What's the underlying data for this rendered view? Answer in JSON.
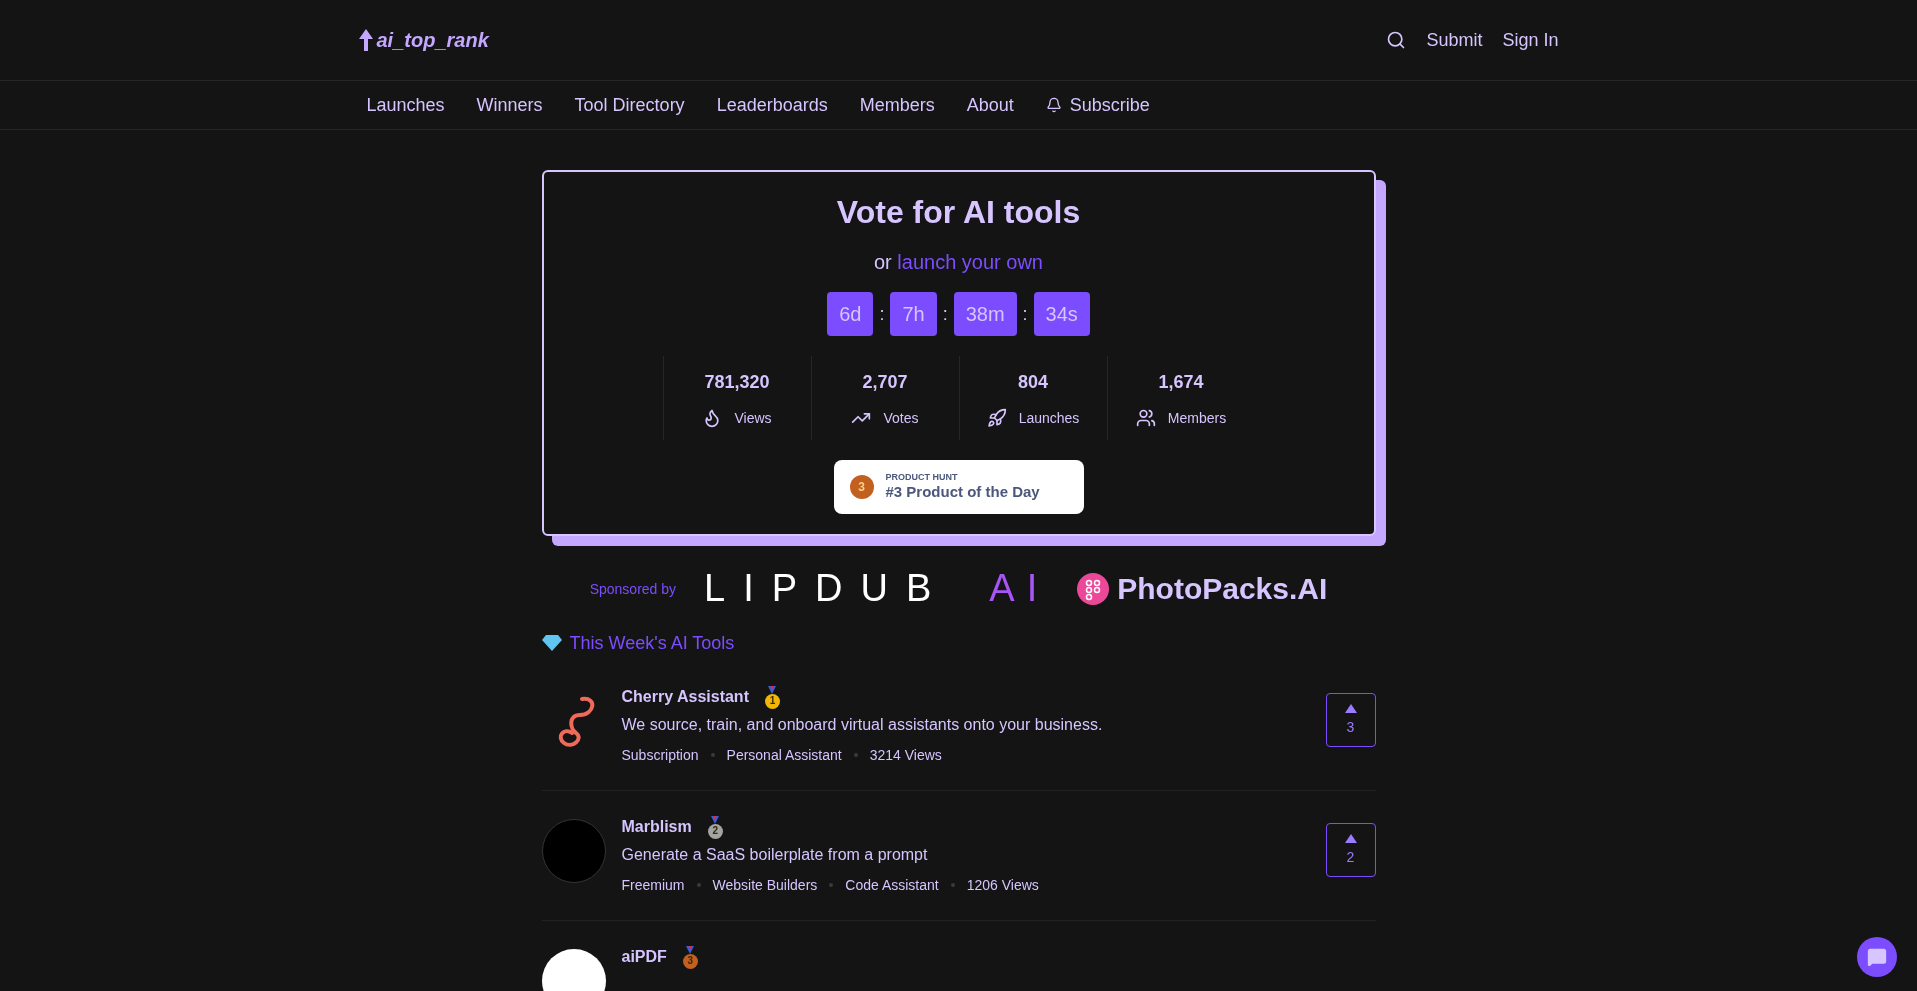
{
  "header": {
    "logo": "ai_top_rank",
    "actions": [
      "Submit",
      "Sign In"
    ]
  },
  "nav": [
    {
      "label": "Launches",
      "kind": "link"
    },
    {
      "label": "Winners",
      "kind": "link"
    },
    {
      "label": "Tool Directory",
      "kind": "link"
    },
    {
      "label": "Leaderboards",
      "kind": "link"
    },
    {
      "label": "Members",
      "kind": "link"
    },
    {
      "label": "About",
      "kind": "link"
    },
    {
      "label": "Subscribe",
      "kind": "bell"
    }
  ],
  "hero": {
    "title": "Vote for AI tools",
    "subtitle_prefix": "or",
    "subtitle_link": "launch your own",
    "countdown": [
      "6d",
      "7h",
      "38m",
      "34s"
    ],
    "separator": ":",
    "stats": [
      {
        "value": "781,320",
        "label": "Views",
        "kind": "flame"
      },
      {
        "value": "2,707",
        "label": "Votes",
        "kind": "trend"
      },
      {
        "value": "804",
        "label": "Launches",
        "kind": "rocket"
      },
      {
        "value": "1,674",
        "label": "Members",
        "kind": "users"
      }
    ],
    "badge": {
      "rank": "3",
      "overline": "PRODUCT HUNT",
      "text": "#3 Product of the Day"
    }
  },
  "sponsors": {
    "label": "Sponsored by",
    "items": [
      {
        "kind": "lipdub",
        "name": "LIPDUB",
        "suffix": "AI"
      },
      {
        "kind": "photopacks",
        "name": "PhotoPacks.AI"
      }
    ]
  },
  "section_title": "This Week's AI Tools",
  "tools": [
    {
      "name": "Cherry Assistant",
      "kind": "swirl",
      "medal": "1",
      "color": "#f2b705",
      "description": "We source, train, and onboard virtual assistants onto your business.",
      "tags": [
        "Subscription",
        "Personal Assistant",
        "3214 Views"
      ],
      "votes": "3"
    },
    {
      "name": "Marblism",
      "kind": "dark",
      "medal": "2",
      "color": "#a3a3a3",
      "description": "Generate a SaaS boilerplate from a prompt",
      "tags": [
        "Freemium",
        "Website Builders",
        "Code Assistant",
        "1206 Views"
      ],
      "votes": "2"
    },
    {
      "name": "aiPDF",
      "kind": "light",
      "medal": "3",
      "color": "#c2611f"
    }
  ]
}
